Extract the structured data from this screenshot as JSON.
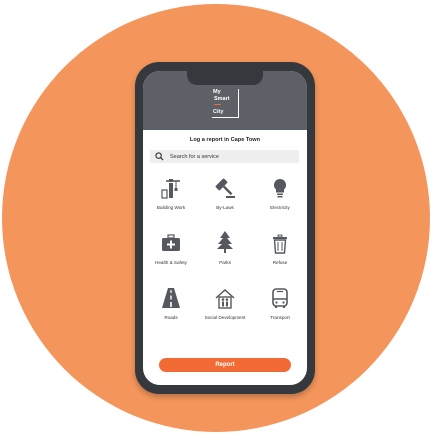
{
  "logo": {
    "line1": "My",
    "line2": "Smart",
    "line3": "City"
  },
  "title": "Log a report in Cape Town",
  "search": {
    "placeholder": "Search for a service"
  },
  "services": [
    {
      "label": "Building Work",
      "icon": "building-icon"
    },
    {
      "label": "By-Laws",
      "icon": "gavel-icon"
    },
    {
      "label": "Electricity",
      "icon": "lightbulb-icon"
    },
    {
      "label": "Health & Safety",
      "icon": "first-aid-icon"
    },
    {
      "label": "Parks",
      "icon": "tree-icon"
    },
    {
      "label": "Refuse",
      "icon": "trash-icon"
    },
    {
      "label": "Roads",
      "icon": "road-icon"
    },
    {
      "label": "Social Development",
      "icon": "family-house-icon"
    },
    {
      "label": "Transport",
      "icon": "bus-icon"
    }
  ],
  "report_button": "Report",
  "colors": {
    "accent": "#f26b35",
    "background_circle": "#f4965c",
    "header": "#5d6066",
    "icon": "#55585e"
  }
}
